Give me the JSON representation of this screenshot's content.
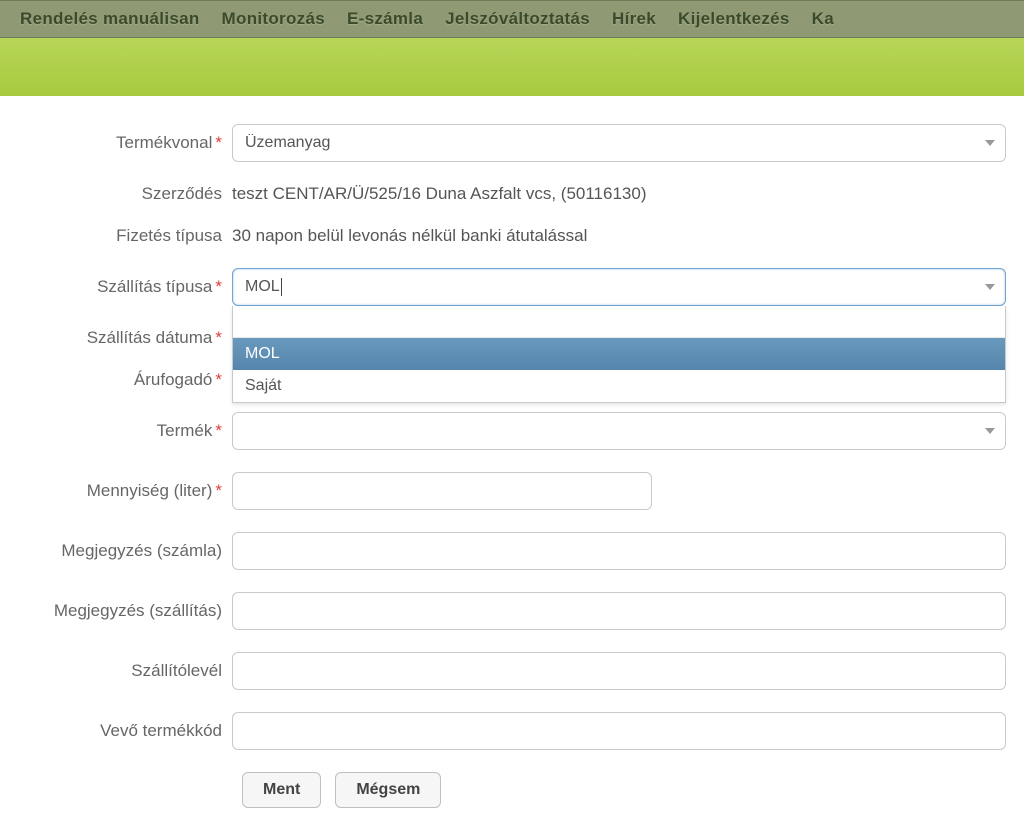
{
  "nav": {
    "items": [
      "Rendelés manuálisan",
      "Monitorozás",
      "E-számla",
      "Jelszóváltoztatás",
      "Hírek",
      "Kijelentkezés",
      "Ka"
    ]
  },
  "form": {
    "product_line": {
      "label": "Termékvonal",
      "value": "Üzemanyag"
    },
    "contract": {
      "label": "Szerződés",
      "value": "teszt CENT/AR/Ü/525/16 Duna Aszfalt vcs, (50116130)"
    },
    "payment_type": {
      "label": "Fizetés típusa",
      "value": "30 napon belül levonás nélkül banki átutalással"
    },
    "delivery_type": {
      "label": "Szállítás típusa",
      "value": "MOL",
      "options": [
        "MOL",
        "Saját"
      ]
    },
    "delivery_date": {
      "label": "Szállítás dátuma"
    },
    "consignee": {
      "label": "Árufogadó"
    },
    "product": {
      "label": "Termék",
      "value": ""
    },
    "quantity": {
      "label": "Mennyiség (liter)",
      "value": ""
    },
    "note_invoice": {
      "label": "Megjegyzés (számla)",
      "value": ""
    },
    "note_delivery": {
      "label": "Megjegyzés (szállítás)",
      "value": ""
    },
    "delivery_note": {
      "label": "Szállítólevél",
      "value": ""
    },
    "buyer_code": {
      "label": "Vevő termékkód",
      "value": ""
    }
  },
  "buttons": {
    "save": "Ment",
    "cancel": "Mégsem"
  }
}
